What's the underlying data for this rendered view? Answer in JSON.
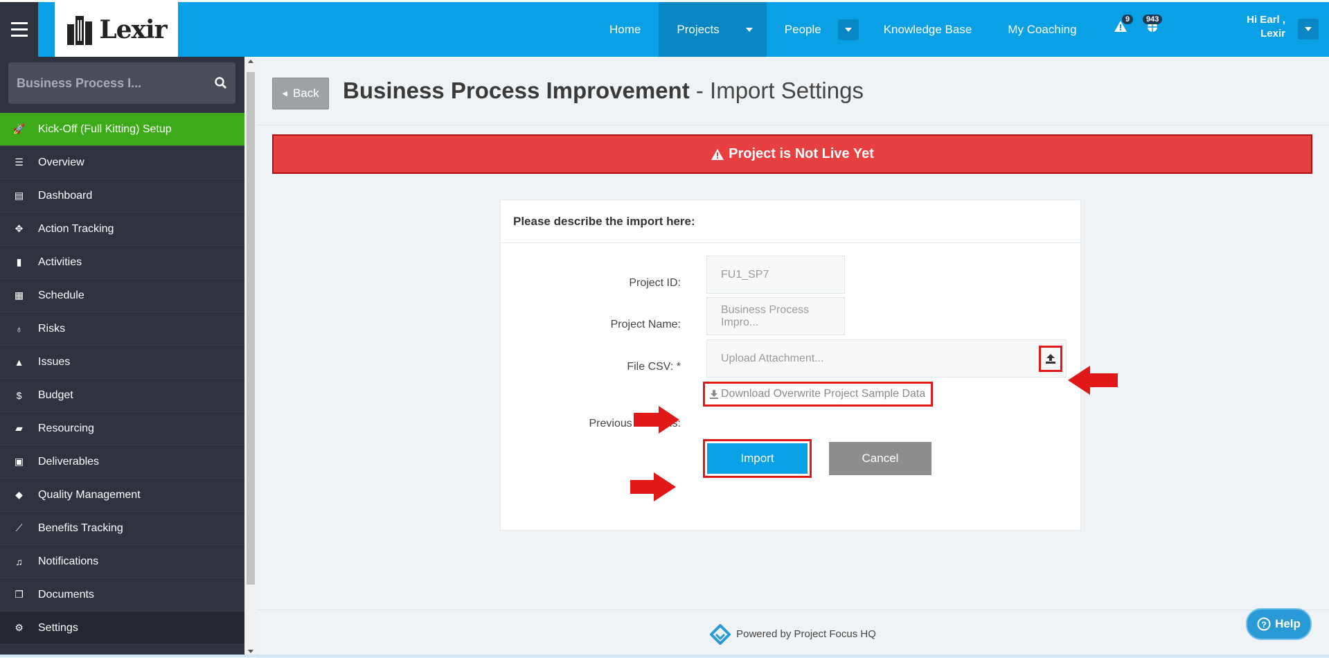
{
  "header": {
    "logo_text": "Lexir",
    "nav": [
      {
        "label": "Home"
      },
      {
        "label": "Projects"
      },
      {
        "label": "People"
      },
      {
        "label": "Knowledge Base"
      },
      {
        "label": "My Coaching"
      }
    ],
    "alerts_count": "9",
    "notifications_count": "943",
    "user_greeting": "Hi Earl ,",
    "user_name": "Lexir",
    "accent_color": "#0aa0e6"
  },
  "sidebar": {
    "search_text": "Business Process I...",
    "items": [
      {
        "label": "Kick-Off (Full Kitting) Setup",
        "icon": "rocket-icon"
      },
      {
        "label": "Overview",
        "icon": "list-icon"
      },
      {
        "label": "Dashboard",
        "icon": "dashboard-icon"
      },
      {
        "label": "Action Tracking",
        "icon": "crosshair-icon"
      },
      {
        "label": "Activities",
        "icon": "bookmark-icon"
      },
      {
        "label": "Schedule",
        "icon": "calendar-icon"
      },
      {
        "label": "Risks",
        "icon": "lightbulb-icon"
      },
      {
        "label": "Issues",
        "icon": "warning-icon"
      },
      {
        "label": "Budget",
        "icon": "dollar-icon"
      },
      {
        "label": "Resourcing",
        "icon": "folder-open-icon"
      },
      {
        "label": "Deliverables",
        "icon": "truck-icon"
      },
      {
        "label": "Quality Management",
        "icon": "tag-icon"
      },
      {
        "label": "Benefits Tracking",
        "icon": "line-chart-icon"
      },
      {
        "label": "Notifications",
        "icon": "bell-icon"
      },
      {
        "label": "Documents",
        "icon": "copy-icon"
      },
      {
        "label": "Settings",
        "icon": "cogs-icon"
      }
    ]
  },
  "page": {
    "back_label": "Back",
    "title_bold": "Business Process Improvement",
    "title_rest": " - Import Settings",
    "alert_text": "Project is Not Live Yet",
    "alert_color": "#e84040"
  },
  "form": {
    "heading": "Please describe the import here:",
    "project_id_label": "Project ID:",
    "project_id_value": "FU1_SP7",
    "project_name_label": "Project Name:",
    "project_name_value": "Business Process Impro...",
    "file_label": "File CSV: *",
    "file_placeholder": "Upload Attachment...",
    "download_link": "Download Overwrite Project Sample Data",
    "previous_versions_label": "Previous Versions:",
    "import_label": "Import",
    "cancel_label": "Cancel"
  },
  "footer": {
    "powered_by": "Powered by Project Focus HQ",
    "help_label": "Help"
  }
}
